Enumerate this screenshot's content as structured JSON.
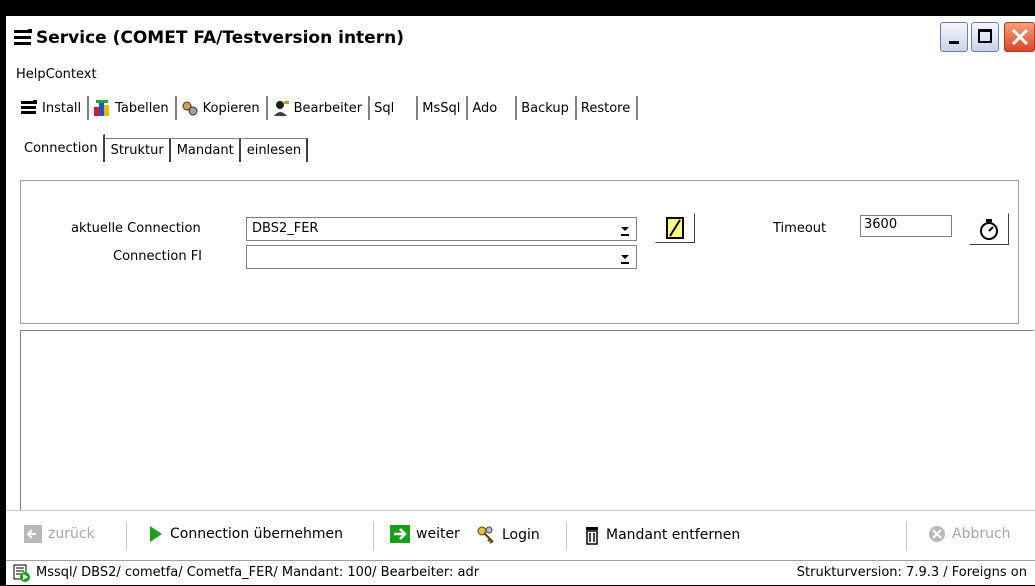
{
  "window": {
    "title": "Service (COMET FA/Testversion intern)"
  },
  "menu": {
    "help_context": "HelpContext"
  },
  "main_tabs": [
    {
      "label": "Install",
      "icon": "install-icon"
    },
    {
      "label": "Tabellen",
      "icon": "tables-icon"
    },
    {
      "label": "Kopieren",
      "icon": "copy-gears-icon"
    },
    {
      "label": "Bearbeiter",
      "icon": "editor-user-icon"
    },
    {
      "label": "Sql"
    },
    {
      "label": "MsSql"
    },
    {
      "label": "Ado"
    },
    {
      "label": "Backup"
    },
    {
      "label": "Restore"
    }
  ],
  "sub_tabs": [
    {
      "label": "Connection",
      "active": true
    },
    {
      "label": "Struktur"
    },
    {
      "label": "Mandant"
    },
    {
      "label": "einlesen"
    }
  ],
  "form": {
    "current_connection_label": "aktuelle Connection",
    "current_connection_value": "DBS2_FER",
    "connection_fi_label": "Connection FI",
    "connection_fi_value": "",
    "timeout_label": "Timeout",
    "timeout_value": "3600"
  },
  "toolbar": {
    "back": "zurück",
    "apply_connection": "Connection übernehmen",
    "next": "weiter",
    "login": "Login",
    "remove_client": "Mandant entfernen",
    "cancel": "Abbruch"
  },
  "status": {
    "left": "Mssql/ DBS2/ cometfa/ Cometfa_FER/ Mandant: 100/ Bearbeiter: adr",
    "right": "Strukturversion: 7.9.3 / Foreigns on"
  }
}
